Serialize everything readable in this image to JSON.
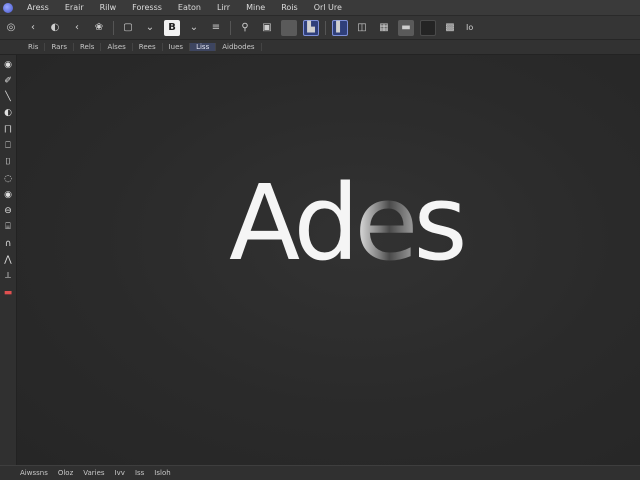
{
  "menubar": {
    "items": [
      "Aress",
      "Erair",
      "Rilw",
      "Foresss",
      "Eaton",
      "Lirr",
      "Mine",
      "Rois",
      "Orl Ure"
    ]
  },
  "toolbar": {
    "white_button_label": "B",
    "zoom_label": "Io"
  },
  "options": {
    "items": [
      "Ris",
      "Rars",
      "Rels",
      "Alses",
      "Rees",
      "Iues",
      "Liss",
      "Aidbodes"
    ]
  },
  "tools": {
    "icons": [
      "◉",
      "✐",
      "╲",
      "◐",
      "⨅",
      "⎕",
      "⌷",
      "◌",
      "◉",
      "⊖",
      "⌸",
      "∩",
      "⋀",
      "⟂",
      "▬"
    ]
  },
  "canvas": {
    "text_a": "A",
    "text_d": "d",
    "text_e": "e",
    "text_s": "s"
  },
  "status": {
    "items": [
      "Aiwssns",
      "Oloz",
      "Varies",
      "Ivv",
      "Iss",
      "Isloh"
    ]
  }
}
